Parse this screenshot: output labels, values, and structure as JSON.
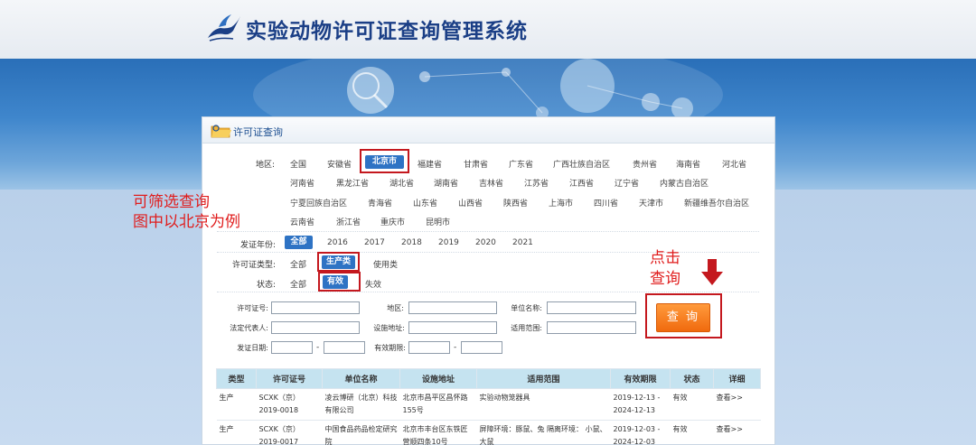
{
  "header": {
    "site_title": "实验动物许可证查询管理系统"
  },
  "panel": {
    "title": "许可证查询"
  },
  "filters": {
    "region_label": "地区:",
    "regions": [
      [
        "全国",
        "安徽省",
        "北京市",
        "福建省",
        "甘肃省",
        "广东省",
        "广西壮族自治区",
        "贵州省",
        "海南省",
        "河北省"
      ],
      [
        "河南省",
        "黑龙江省",
        "湖北省",
        "湖南省",
        "吉林省",
        "江苏省",
        "江西省",
        "辽宁省",
        "内蒙古自治区"
      ],
      [
        "宁夏回族自治区",
        "青海省",
        "山东省",
        "山西省",
        "陕西省",
        "上海市",
        "四川省",
        "天津市",
        "新疆维吾尔自治区"
      ],
      [
        "云南省",
        "浙江省",
        "重庆市",
        "昆明市"
      ]
    ],
    "selected_region": "北京市",
    "year_label": "发证年份:",
    "years": [
      "全部",
      "2016",
      "2017",
      "2018",
      "2019",
      "2020",
      "2021"
    ],
    "selected_year": "全部",
    "type_label": "许可证类型:",
    "types": [
      "全部",
      "生产类",
      "使用类"
    ],
    "selected_type": "生产类",
    "status_label": "状态:",
    "statuses": [
      "全部",
      "有效",
      "失效"
    ],
    "selected_status": "有效"
  },
  "form": {
    "license_no_label": "许可证号:",
    "region_label": "地区:",
    "unit_label": "单位名称:",
    "legal_rep_label": "法定代表人:",
    "facility_label": "设施地址:",
    "scope_label": "适用范围:",
    "issue_date_label": "发证日期:",
    "valid_period_label": "有效期限:",
    "range_sep": "-",
    "search_button": "查 询"
  },
  "annotations": {
    "filter_note_line1": "可筛选查询",
    "filter_note_line2": "图中以北京为例",
    "click_note_line1": "点击",
    "click_note_line2": "查询"
  },
  "table": {
    "columns": [
      "类型",
      "许可证号",
      "单位名称",
      "设施地址",
      "适用范围",
      "有效期限",
      "状态",
      "详细"
    ],
    "rows": [
      {
        "type": "生产",
        "license_no": "SCXK（京）2019-0018",
        "unit": "凌云博研（北京）科技有限公司",
        "facility": "北京市昌平区昌怀路155号",
        "scope": "实验动物笼器具",
        "valid_period": "2019-12-13 - 2024-12-13",
        "status": "有效",
        "detail": "查看>>"
      },
      {
        "type": "生产",
        "license_no": "SCXK（京）2019-0017",
        "unit": "中国食品药品检定研究院",
        "facility": "北京市丰台区东铁匠营顺四条10号",
        "scope": "屏障环境：豚鼠、兔 隔离环境： 小鼠、大鼠",
        "valid_period": "2019-12-03 - 2024-12-03",
        "status": "有效",
        "detail": "查看>>"
      }
    ]
  },
  "colors": {
    "brand_blue": "#1b3f86",
    "selected_blue": "#2e73c4",
    "highlight_red": "#c4181e",
    "search_orange": "#f47b1e",
    "table_header": "#c5e3f0",
    "valid_green": "#16a01a"
  }
}
